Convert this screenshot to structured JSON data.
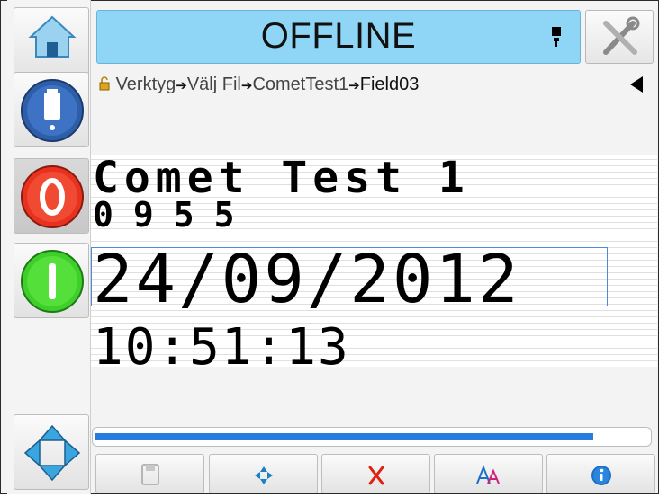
{
  "status": {
    "text": "OFFLINE"
  },
  "breadcrumb": {
    "items": [
      "Verktyg",
      "Välj Fil",
      "CometTest1",
      "Field03"
    ],
    "separator": "➔"
  },
  "message": {
    "lines": [
      "Comet Test 1",
      "0955",
      "24/09/2012",
      "10:51:13"
    ],
    "selected_line": "24/09/2012"
  },
  "progress": {
    "percent": 90
  },
  "icons": {
    "home": "home-icon",
    "ink": "ink-bottle-icon",
    "stop": "stop-icon",
    "start": "start-icon",
    "navigate": "navigate-arrows-icon",
    "tools": "tools-icon",
    "ink_level": "ink-level-icon",
    "lock": "lock-icon",
    "back": "back-arrow-icon",
    "save": "save-icon",
    "move": "move-icon",
    "delete": "delete-icon",
    "font": "font-icon",
    "info": "info-icon"
  },
  "colors": {
    "status_bar": "#8fd6f6",
    "stop": "#e8321f",
    "start": "#3fcf2a",
    "accent": "#2a7bde"
  }
}
